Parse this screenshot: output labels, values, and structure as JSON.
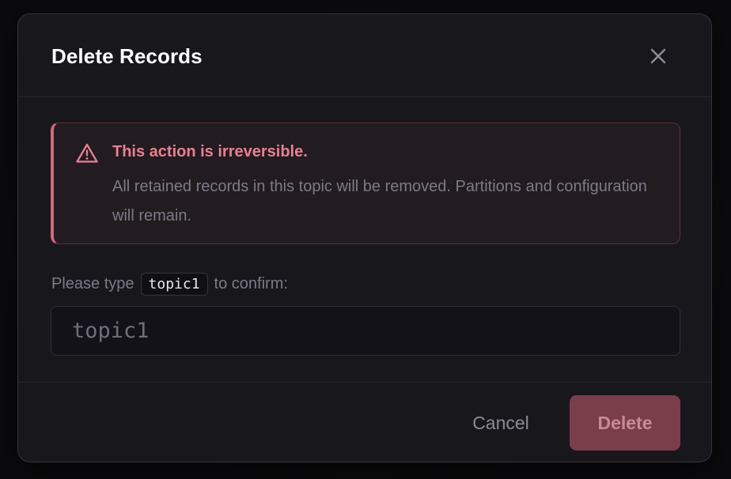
{
  "dialog": {
    "title": "Delete Records",
    "close_icon": "close-icon"
  },
  "alert": {
    "icon": "warning-triangle-icon",
    "title": "This action is irreversible.",
    "body": "All retained records in this topic will be removed. Partitions and configuration will remain.",
    "accent_color": "#d7687c"
  },
  "confirm": {
    "prefix": "Please type",
    "code": "topic1",
    "suffix": "to confirm:",
    "input_value": "",
    "input_placeholder": "topic1"
  },
  "footer": {
    "cancel_label": "Cancel",
    "delete_label": "Delete",
    "delete_disabled": true
  }
}
